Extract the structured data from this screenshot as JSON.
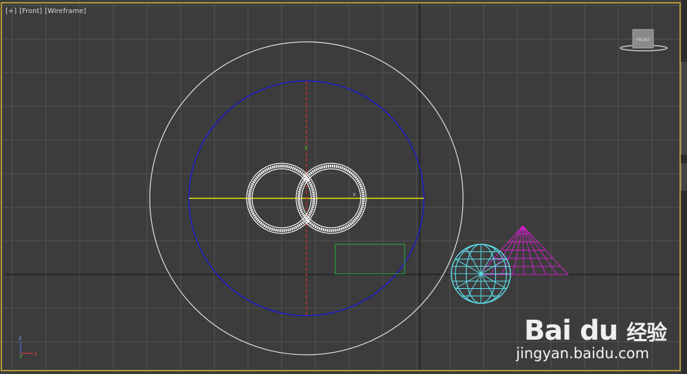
{
  "viewport": {
    "label_plus": "[+]",
    "label_view": "[Front]",
    "label_shading": "[Wireframe]"
  },
  "viewcube": {
    "face_label": "FRONT"
  },
  "gizmo": {
    "y_label": "y",
    "x_label": "x"
  },
  "axis_tripod": {
    "z_label": "z",
    "y_label": "y",
    "x_label": "x"
  },
  "watermark": {
    "brand": "Bai du",
    "cn": "经验",
    "url": "jingyan.baidu.com"
  },
  "colors": {
    "background": "#3c3c3c",
    "grid": "#555555",
    "border": "#b49a3a",
    "outer_circle": "#e6e6e6",
    "inner_circle": "#1b1bd0",
    "horizontal_line": "#e6e600",
    "vertical_axis": "#c0302a",
    "rings": "#ffffff",
    "rectangle": "#2aa040",
    "sphere": "#5fe3f0",
    "pyramid": "#d020c8"
  }
}
